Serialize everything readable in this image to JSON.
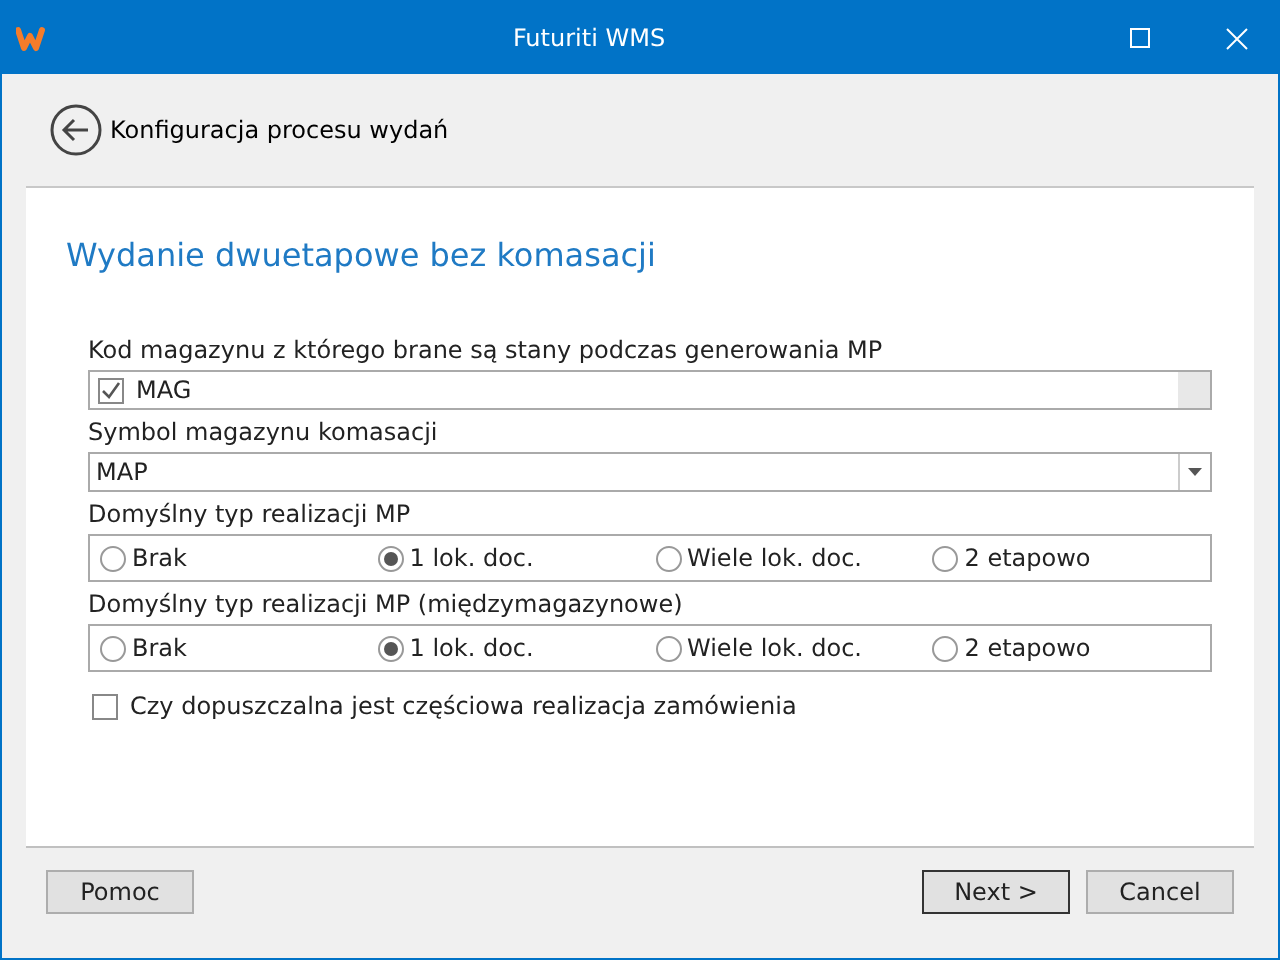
{
  "window": {
    "title": "Futuriti WMS"
  },
  "header": {
    "title": "Konfiguracja procesu wydań"
  },
  "page_title": "Wydanie dwuetapowe bez komasacji",
  "fields": [
    {
      "kind": "checklist",
      "label": "Kod magazynu z którego brane są stany podczas generowania MP",
      "items": [
        {
          "label": "MAG",
          "checked": true
        }
      ]
    },
    {
      "kind": "dropdown",
      "label": "Symbol magazynu komasacji",
      "value": "MAP"
    },
    {
      "kind": "radio",
      "label": "Domyślny typ realizacji MP",
      "options": [
        {
          "label": "Brak",
          "selected": false
        },
        {
          "label": "1 lok. doc.",
          "selected": true
        },
        {
          "label": "Wiele lok. doc.",
          "selected": false
        },
        {
          "label": "2 etapowo",
          "selected": false
        }
      ]
    },
    {
      "kind": "radio",
      "label": "Domyślny typ realizacji MP (międzymagazynowe)",
      "options": [
        {
          "label": "Brak",
          "selected": false
        },
        {
          "label": "1 lok. doc.",
          "selected": true
        },
        {
          "label": "Wiele lok. doc.",
          "selected": false
        },
        {
          "label": "2 etapowo",
          "selected": false
        }
      ]
    },
    {
      "kind": "checkbox",
      "label": "Czy dopuszczalna jest częściowa realizacja zamówienia",
      "checked": false
    }
  ],
  "buttons": [
    {
      "label": "Pomoc",
      "default": false
    },
    {
      "label": "Next >",
      "default": true
    },
    {
      "label": "Cancel",
      "default": false
    }
  ]
}
